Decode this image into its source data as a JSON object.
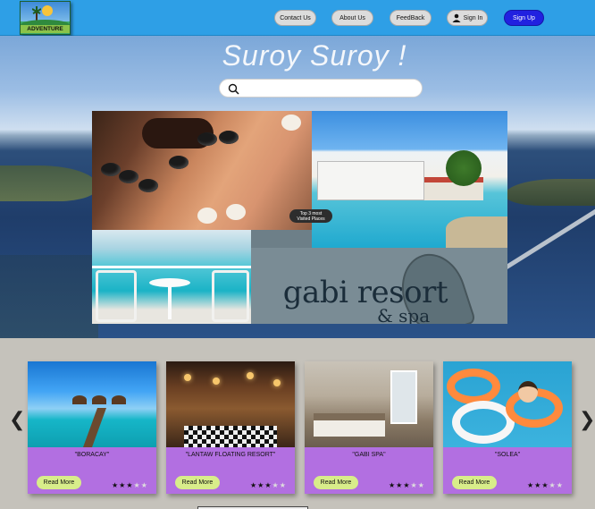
{
  "nav": {
    "logo_label": "ADVENTURE",
    "contact": "Contact Us",
    "about": "About Us",
    "feedback": "FeedBack",
    "signin": "Sign In",
    "signup": "Sign Up",
    "colors": {
      "bar": "#2e9fe6",
      "signup": "#2121e0"
    }
  },
  "hero": {
    "title": "Suroy Suroy !",
    "search_placeholder": "",
    "badge_line1": "Top 3 most",
    "badge_line2": "Visited Places",
    "brand_name": "gabi resort",
    "brand_sub": "& spa"
  },
  "cards": [
    {
      "name": "\"BORACAY\"",
      "read": "Read More",
      "rating": 3,
      "max": 5
    },
    {
      "name": "\"LANTAW FLOATING RESORT\"",
      "read": "Read More",
      "rating": 3,
      "max": 5
    },
    {
      "name": "\"GABI SPA\"",
      "read": "Read More",
      "rating": 3,
      "max": 5
    },
    {
      "name": "\"SOLEA\"",
      "read": "Read More",
      "rating": 3,
      "max": 5
    }
  ],
  "carousel": {
    "prev": "❮",
    "next": "❯"
  },
  "card_color": "#b26fe1",
  "read_more_color": "#d8ed8a"
}
